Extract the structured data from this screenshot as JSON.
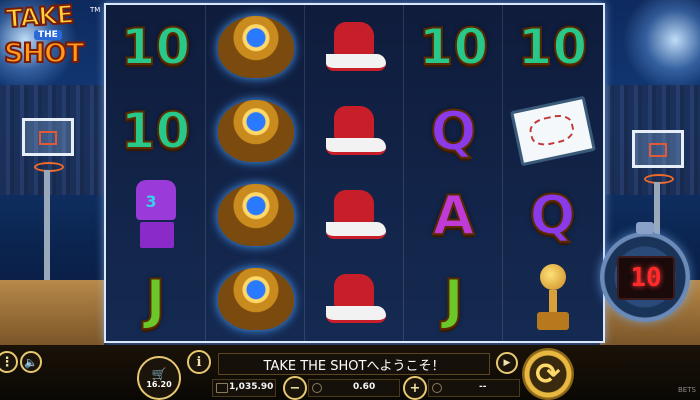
{
  "logo": {
    "take": "TAKE",
    "the": "THE",
    "shot": "SHOT",
    "tm": "TM"
  },
  "reels": [
    [
      "10",
      "ring",
      "shoe",
      "10",
      "10"
    ],
    [
      "10",
      "ring",
      "shoe",
      "Q",
      "clipboard"
    ],
    [
      "jersey",
      "ring",
      "shoe",
      "A",
      "Q"
    ],
    [
      "J",
      "ring",
      "shoe",
      "J",
      "trophy"
    ]
  ],
  "jersey_number": "3",
  "timer": {
    "display": "10"
  },
  "bottom_bar": {
    "menu_icon": "menu-icon",
    "sound_icon": "speaker-icon",
    "cart_icon": "cart-icon",
    "cart_value": "16.20",
    "info_label": "i",
    "message": "TAKE THE SHOTへようこそ！",
    "balance": "1,035.90",
    "bet": "0.60",
    "win": "--",
    "minus_label": "−",
    "plus_label": "+",
    "spin_icon": "spin-icon",
    "brand": "BETS"
  },
  "colors": {
    "ten": "#27c88a",
    "q": "#8a3ae8",
    "a": "#c03ad8",
    "j": "#6ac82a",
    "frame": "#d9e7ff",
    "gold": "#e8b840"
  }
}
